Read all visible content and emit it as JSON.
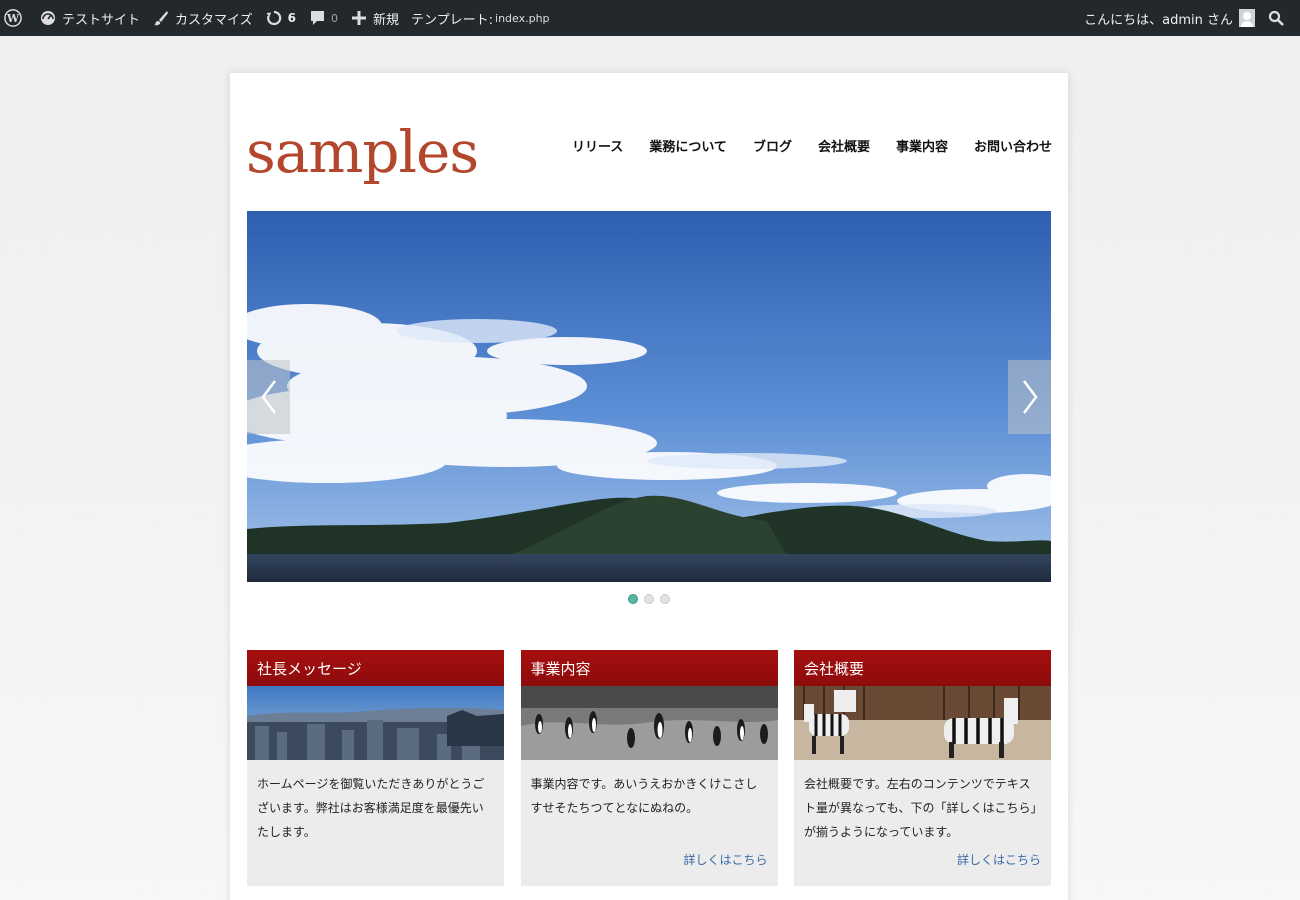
{
  "adminbar": {
    "site_name": "テストサイト",
    "customize": "カスタマイズ",
    "updates_count": "6",
    "comments_count": "0",
    "new_label": "新規",
    "template_label": "テンプレート:",
    "template_value": "index.php",
    "greeting": "こんにちは、admin さん"
  },
  "site": {
    "logo": "samples",
    "nav": [
      "リリース",
      "業務について",
      "ブログ",
      "会社概要",
      "事業内容",
      "お問い合わせ"
    ]
  },
  "slider": {
    "slide_count": 3,
    "active_index": 0
  },
  "cards": [
    {
      "title": "社長メッセージ",
      "text": "ホームページを御覧いただきありがとうございます。弊社はお客様満足度を最優先いたします。",
      "more": ""
    },
    {
      "title": "事業内容",
      "text": "事業内容です。あいうえおかきくけこさしすせそたちつてとなにぬねの。",
      "more": "詳しくはこちら"
    },
    {
      "title": "会社概要",
      "text": "会社概要です。左右のコンテンツでテキスト量が異なっても、下の「詳しくはこちら」が揃うようになっています。",
      "more": "詳しくはこちら"
    }
  ],
  "colors": {
    "adminbar_bg": "#23282d",
    "logo": "#b3472d",
    "card_header": "#a60f0f",
    "link": "#3a6aa8",
    "active_dot": "#57b6a0"
  }
}
